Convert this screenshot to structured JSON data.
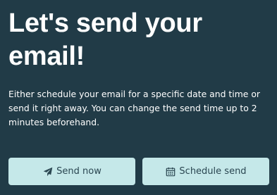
{
  "main": {
    "title": "Let's send your email!",
    "description": "Either schedule your email for a specific date and time or send it right away. You can change the send time up to 2 minutes beforehand."
  },
  "actions": {
    "send_now": {
      "label": "Send now",
      "icon": "paper-plane-icon"
    },
    "schedule_send": {
      "label": "Schedule send",
      "icon": "calendar-icon"
    }
  },
  "colors": {
    "background": "#213b47",
    "button_background": "#c5e8e9",
    "button_text": "#2a4651",
    "text": "#ffffff"
  }
}
